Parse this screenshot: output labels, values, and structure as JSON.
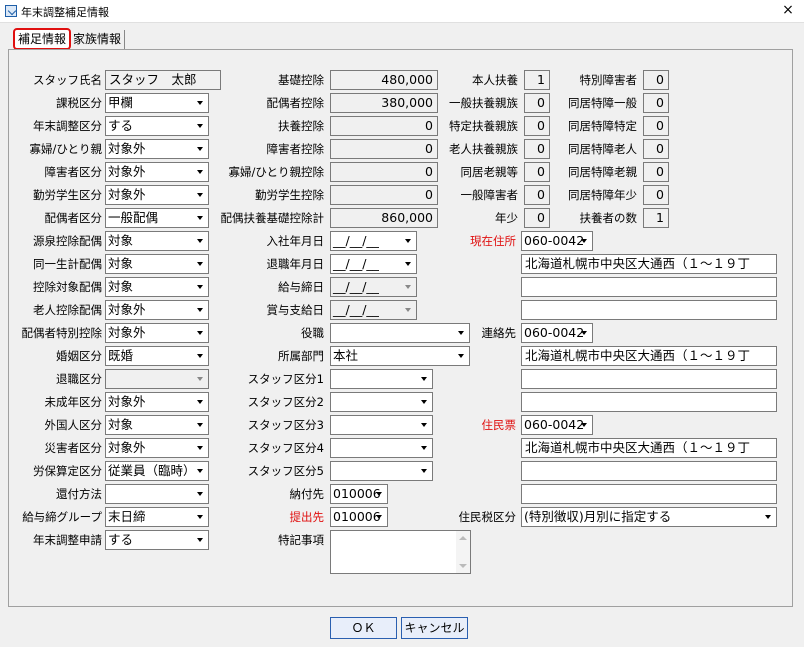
{
  "window": {
    "title": "年末調整補足情報",
    "close": "×"
  },
  "tabs": [
    "補足情報",
    "家族情報"
  ],
  "col1": [
    {
      "label": "スタッフ氏名",
      "value": "スタッフ　太郎",
      "kind": "text"
    },
    {
      "label": "課税区分",
      "value": "甲欄",
      "kind": "select"
    },
    {
      "label": "年末調整区分",
      "value": "する",
      "kind": "select"
    },
    {
      "label": "寡婦/ひとり親",
      "value": "対象外",
      "kind": "select"
    },
    {
      "label": "障害者区分",
      "value": "対象外",
      "kind": "select"
    },
    {
      "label": "勤労学生区分",
      "value": "対象外",
      "kind": "select"
    },
    {
      "label": "配偶者区分",
      "value": "一般配偶",
      "kind": "select"
    },
    {
      "label": "源泉控除配偶",
      "value": "対象",
      "kind": "select"
    },
    {
      "label": "同一生計配偶",
      "value": "対象",
      "kind": "select"
    },
    {
      "label": "控除対象配偶",
      "value": "対象",
      "kind": "select"
    },
    {
      "label": "老人控除配偶",
      "value": "対象外",
      "kind": "select"
    },
    {
      "label": "配偶者特別控除",
      "value": "対象外",
      "kind": "select"
    },
    {
      "label": "婚姻区分",
      "value": "既婚",
      "kind": "select"
    },
    {
      "label": "退職区分",
      "value": "",
      "kind": "select-dis"
    },
    {
      "label": "未成年区分",
      "value": "対象外",
      "kind": "select"
    },
    {
      "label": "外国人区分",
      "value": "対象",
      "kind": "select"
    },
    {
      "label": "災害者区分",
      "value": "対象外",
      "kind": "select"
    },
    {
      "label": "労保算定区分",
      "value": "従業員（臨時）",
      "kind": "select"
    },
    {
      "label": "還付方法",
      "value": "",
      "kind": "select"
    },
    {
      "label": "給与締グループ",
      "value": "末日締",
      "kind": "select"
    },
    {
      "label": "年末調整申請",
      "value": "する",
      "kind": "select"
    }
  ],
  "deductions": [
    {
      "label": "基礎控除",
      "value": "480,000"
    },
    {
      "label": "配偶者控除",
      "value": "380,000"
    },
    {
      "label": "扶養控除",
      "value": "0"
    },
    {
      "label": "障害者控除",
      "value": "0"
    },
    {
      "label": "寡婦/ひとり親控除",
      "value": "0"
    },
    {
      "label": "勤労学生控除",
      "value": "0"
    },
    {
      "label": "配偶扶養基礎控除計",
      "value": "860,000"
    }
  ],
  "dates": [
    {
      "label": "入社年月日",
      "value": "__/__/__"
    },
    {
      "label": "退職年月日",
      "value": "__/__/__"
    },
    {
      "label": "給与締日",
      "value": "__/__/__"
    },
    {
      "label": "賞与支給日",
      "value": "__/__/__"
    }
  ],
  "col3": [
    {
      "label": "役職",
      "value": ""
    },
    {
      "label": "所属部門",
      "value": "本社"
    },
    {
      "label": "スタッフ区分1",
      "value": ""
    },
    {
      "label": "スタッフ区分2",
      "value": ""
    },
    {
      "label": "スタッフ区分3",
      "value": ""
    },
    {
      "label": "スタッフ区分4",
      "value": ""
    },
    {
      "label": "スタッフ区分5",
      "value": ""
    }
  ],
  "payee": {
    "label": "納付先",
    "value": "010006"
  },
  "submit_to": {
    "label": "提出先",
    "value": "010006"
  },
  "notes_label": "特記事項",
  "dependents_left": [
    {
      "label": "本人扶養",
      "value": "1"
    },
    {
      "label": "一般扶養親族",
      "value": "0"
    },
    {
      "label": "特定扶養親族",
      "value": "0"
    },
    {
      "label": "老人扶養親族",
      "value": "0"
    },
    {
      "label": "同居老親等",
      "value": "0"
    },
    {
      "label": "一般障害者",
      "value": "0"
    },
    {
      "label": "年少",
      "value": "0"
    }
  ],
  "dependents_right": [
    {
      "label": "特別障害者",
      "value": "0"
    },
    {
      "label": "同居特障一般",
      "value": "0"
    },
    {
      "label": "同居特障特定",
      "value": "0"
    },
    {
      "label": "同居特障老人",
      "value": "0"
    },
    {
      "label": "同居特障老親",
      "value": "0"
    },
    {
      "label": "同居特障年少",
      "value": "0"
    },
    {
      "label": "扶養者の数",
      "value": "1"
    }
  ],
  "address": {
    "current": {
      "label": "現在住所",
      "postal": "060-0042",
      "addr": "北海道札幌市中央区大通西（１～１９丁"
    },
    "contact": {
      "label": "連絡先",
      "postal": "060-0042",
      "addr": "北海道札幌市中央区大通西（１～１９丁"
    },
    "resident": {
      "label": "住民票",
      "postal": "060-0042",
      "addr": "北海道札幌市中央区大通西（１～１９丁"
    }
  },
  "residence_tax": {
    "label": "住民税区分",
    "value": "(特別徴収)月別に指定する"
  },
  "buttons": {
    "ok": "ＯＫ",
    "cancel": "キャンセル"
  }
}
